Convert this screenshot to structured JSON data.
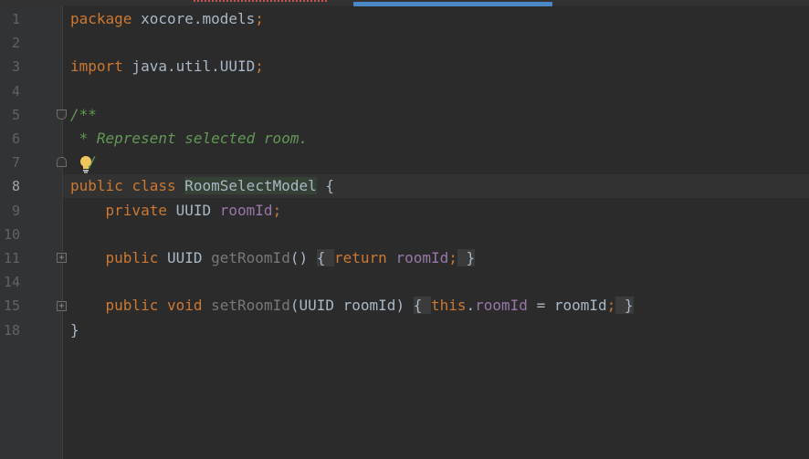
{
  "editor": {
    "language": "java",
    "current_line": "8",
    "line_numbers": [
      "1",
      "2",
      "3",
      "4",
      "5",
      "6",
      "7",
      "8",
      "9",
      "10",
      "11",
      "14",
      "15",
      "18"
    ],
    "lines": [
      {
        "tokens": [
          {
            "t": "package",
            "c": "kw"
          },
          {
            "t": " xocore.models",
            "c": "plain"
          },
          {
            "t": ";",
            "c": "kw"
          }
        ]
      },
      {
        "tokens": []
      },
      {
        "tokens": [
          {
            "t": "import",
            "c": "kw"
          },
          {
            "t": " java.util.UUID",
            "c": "plain"
          },
          {
            "t": ";",
            "c": "kw"
          }
        ]
      },
      {
        "tokens": []
      },
      {
        "tokens": [
          {
            "t": "/**",
            "c": "comment"
          }
        ]
      },
      {
        "tokens": [
          {
            "t": " * Represent selected room.",
            "c": "comment"
          }
        ]
      },
      {
        "tokens": [
          {
            "t": "  /",
            "c": "comment"
          }
        ]
      },
      {
        "tokens": [
          {
            "t": "public",
            "c": "kw"
          },
          {
            "t": " ",
            "c": "plain"
          },
          {
            "t": "class",
            "c": "kw"
          },
          {
            "t": " ",
            "c": "plain"
          },
          {
            "t": "RoomSelectModel",
            "c": "highlight-class"
          },
          {
            "t": " {",
            "c": "plain"
          }
        ]
      },
      {
        "tokens": [
          {
            "t": "    ",
            "c": "plain"
          },
          {
            "t": "private",
            "c": "kw"
          },
          {
            "t": " UUID ",
            "c": "plain"
          },
          {
            "t": "roomId",
            "c": "field"
          },
          {
            "t": ";",
            "c": "kw"
          }
        ]
      },
      {
        "tokens": []
      },
      {
        "tokens": [
          {
            "t": "    ",
            "c": "plain"
          },
          {
            "t": "public",
            "c": "kw"
          },
          {
            "t": " UUID ",
            "c": "plain"
          },
          {
            "t": "getRoomId",
            "c": "unused"
          },
          {
            "t": "() ",
            "c": "plain"
          },
          {
            "t": "{ ",
            "c": "fold-bg"
          },
          {
            "t": "return",
            "c": "kw"
          },
          {
            "t": " ",
            "c": "plain"
          },
          {
            "t": "roomId",
            "c": "field"
          },
          {
            "t": ";",
            "c": "kw"
          },
          {
            "t": " }",
            "c": "fold-bg"
          }
        ]
      },
      {
        "tokens": []
      },
      {
        "tokens": [
          {
            "t": "    ",
            "c": "plain"
          },
          {
            "t": "public",
            "c": "kw"
          },
          {
            "t": " ",
            "c": "plain"
          },
          {
            "t": "void",
            "c": "kw"
          },
          {
            "t": " ",
            "c": "plain"
          },
          {
            "t": "setRoomId",
            "c": "unused"
          },
          {
            "t": "(UUID roomId) ",
            "c": "plain"
          },
          {
            "t": "{ ",
            "c": "fold-bg"
          },
          {
            "t": "this",
            "c": "kw"
          },
          {
            "t": ".",
            "c": "plain"
          },
          {
            "t": "roomId",
            "c": "field"
          },
          {
            "t": " = roomId",
            "c": "plain"
          },
          {
            "t": ";",
            "c": "kw"
          },
          {
            "t": " }",
            "c": "fold-bg"
          }
        ]
      },
      {
        "tokens": [
          {
            "t": "}",
            "c": "plain"
          }
        ]
      }
    ]
  },
  "icons": {
    "intention_bulb": "lightbulb-icon",
    "fold_marker": "fold-icon"
  },
  "colors": {
    "background": "#2b2b2b",
    "keyword": "#cc7832",
    "comment": "#629755",
    "field": "#9876aa",
    "text": "#a9b7c6",
    "bulb": "#f2c55c"
  }
}
